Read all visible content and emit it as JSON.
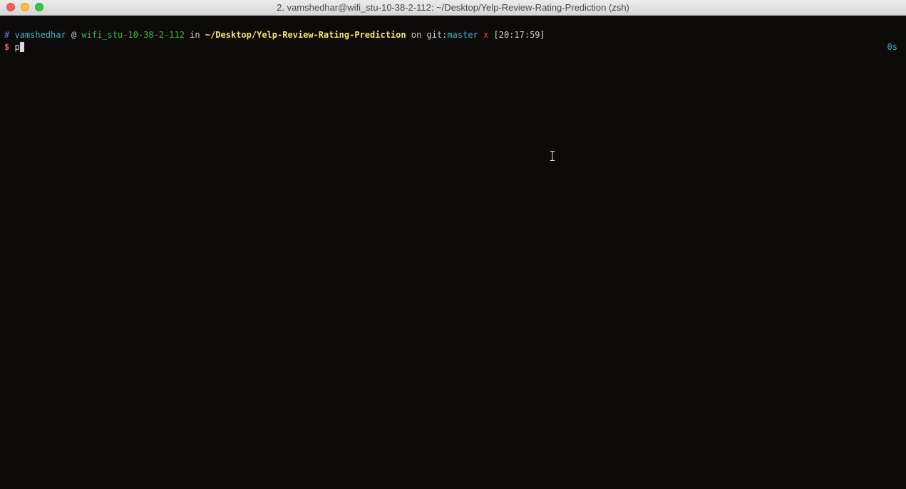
{
  "window": {
    "title": "2. vamshedhar@wifi_stu-10-38-2-112: ~/Desktop/Yelp-Review-Rating-Prediction (zsh)"
  },
  "prompt": {
    "hash": "#",
    "user": "vamshedhar",
    "at": "@",
    "host": "wifi_stu-10-38-2-112",
    "in": "in",
    "path": "~/Desktop/Yelp-Review-Rating-Prediction",
    "on": "on",
    "git_prefix": "git:",
    "branch": "master",
    "dirty_marker": "x",
    "time": "[20:17:59]",
    "symbol": "$",
    "input": "p",
    "duration": "0s"
  },
  "colors": {
    "background": "#0c0b0a",
    "user": "#35b3c8",
    "host": "#34b94a",
    "path": "#f2e66b",
    "dirty": "#e0443e",
    "prompt_symbol": "#e85a52"
  },
  "icons": {
    "mouse_cursor": "ibeam-cursor-icon"
  }
}
